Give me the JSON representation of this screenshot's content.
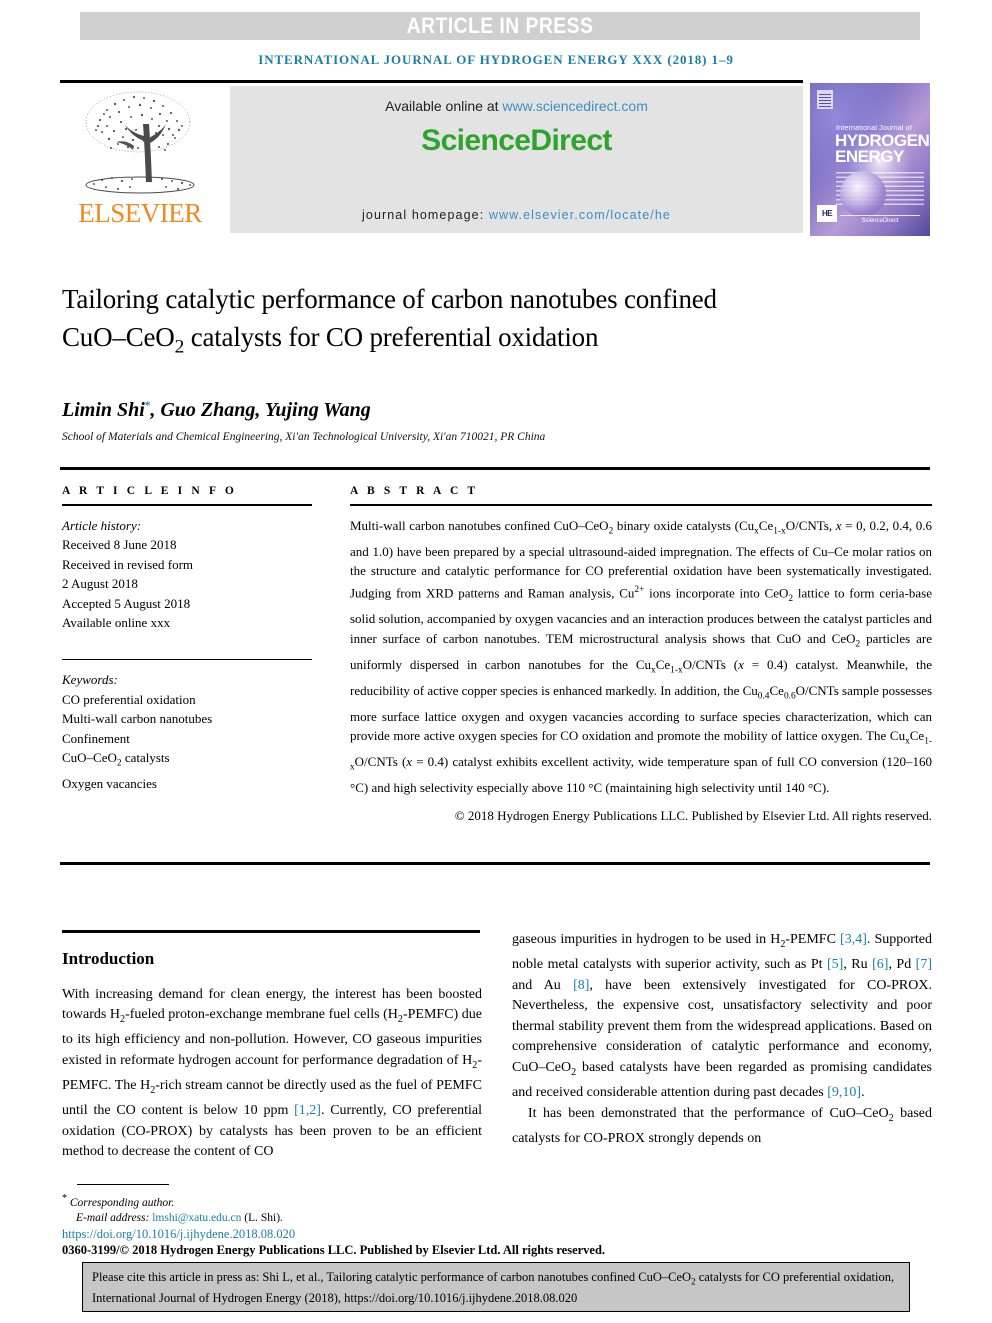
{
  "banner": {
    "label": "ARTICLE IN PRESS",
    "bg_color": "#cfcfcf",
    "text_color": "#ffffff"
  },
  "running_head": {
    "text": "INTERNATIONAL JOURNAL OF HYDROGEN ENERGY XXX (2018) 1–9",
    "color": "#1a7fa8"
  },
  "masthead": {
    "publisher": "ELSEVIER",
    "publisher_color": "#F08A1E",
    "available_prefix": "Available online at ",
    "available_link": "www.sciencedirect.com",
    "sciencedirect_logo": "ScienceDirect",
    "sciencedirect_color": "#2FA32F",
    "homepage_prefix": "journal homepage: ",
    "homepage_link": "www.elsevier.com/locate/he",
    "link_color": "#3a8fc4"
  },
  "cover": {
    "line_small": "International Journal of",
    "line_big_1": "HYDROGEN",
    "line_big_2": "ENERGY",
    "imprint": "HE",
    "publisher_footer": "ScienceDirect"
  },
  "article": {
    "title": "Tailoring catalytic performance of carbon nanotubes confined CuO–CeO₂ catalysts for CO preferential oxidation",
    "authors": "Limin Shi*, Guo Zhang, Yujing Wang",
    "affiliation": "School of Materials and Chemical Engineering, Xi'an Technological University, Xi'an 710021, PR China"
  },
  "info": {
    "heading": "A R T I C L E   I N F O",
    "history_label": "Article history:",
    "history": [
      "Received 8 June 2018",
      "Received in revised form",
      "2 August 2018",
      "Accepted 5 August 2018",
      "Available online xxx"
    ],
    "keywords_label": "Keywords:",
    "keywords": [
      "CO preferential oxidation",
      "Multi-wall carbon nanotubes",
      "Confinement",
      "CuO–CeO₂ catalysts",
      "Oxygen vacancies"
    ]
  },
  "abstract": {
    "heading": "A B S T R A C T",
    "body": "Multi-wall carbon nanotubes confined CuO–CeO₂ binary oxide catalysts (CuₓCe₁₋ₓO/CNTs, x = 0, 0.2, 0.4, 0.6 and 1.0) have been prepared by a special ultrasound-aided impregnation. The effects of Cu–Ce molar ratios on the structure and catalytic performance for CO preferential oxidation have been systematically investigated. Judging from XRD patterns and Raman analysis, Cu²⁺ ions incorporate into CeO₂ lattice to form ceria-base solid solution, accompanied by oxygen vacancies and an interaction produces between the catalyst particles and inner surface of carbon nanotubes. TEM microstructural analysis shows that CuO and CeO₂ particles are uniformly dispersed in carbon nanotubes for the CuₓCe₁₋ₓO/CNTs (x = 0.4) catalyst. Meanwhile, the reducibility of active copper species is enhanced markedly. In addition, the Cu₀.₄Ce₀.₆O/CNTs sample possesses more surface lattice oxygen and oxygen vacancies according to surface species characterization, which can provide more active oxygen species for CO oxidation and promote the mobility of lattice oxygen. The CuₓCe₁₋ₓO/CNTs (x = 0.4) catalyst exhibits excellent activity, wide temperature span of full CO conversion (120–160 °C) and high selectivity especially above 110 °C (maintaining high selectivity until 140 °C).",
    "copyright": "© 2018 Hydrogen Energy Publications LLC. Published by Elsevier Ltd. All rights reserved."
  },
  "body": {
    "intro_heading": "Introduction",
    "left_para": "With increasing demand for clean energy, the interest has been boosted towards H₂-fueled proton-exchange membrane fuel cells (H₂-PEMFC) due to its high efficiency and non-pollution. However, CO gaseous impurities existed in reformate hydrogen account for performance degradation of H₂-PEMFC. The H₂-rich stream cannot be directly used as the fuel of PEMFC until the CO content is below 10 ppm [1,2]. Currently, CO preferential oxidation (CO-PROX) by catalysts has been proven to be an efficient method to decrease the content of CO",
    "right_para_1": "gaseous impurities in hydrogen to be used in H₂-PEMFC [3,4]. Supported noble metal catalysts with superior activity, such as Pt [5], Ru [6], Pd [7] and Au [8], have been extensively investigated for CO-PROX. Nevertheless, the expensive cost, unsatisfactory selectivity and poor thermal stability prevent them from the widespread applications. Based on comprehensive consideration of catalytic performance and economy, CuO–CeO₂ based catalysts have been regarded as promising candidates and received considerable attention during past decades [9,10].",
    "right_para_2": "It has been demonstrated that the performance of CuO–CeO₂ based catalysts for CO-PROX strongly depends on"
  },
  "footer": {
    "corresponding": "Corresponding author.",
    "email_label": "E-mail address: ",
    "email": "lmshi@xatu.edu.cn",
    "email_suffix": " (L. Shi).",
    "doi": "https://doi.org/10.1016/j.ijhydene.2018.08.020",
    "issn": "0360-3199/© 2018 Hydrogen Energy Publications LLC. Published by Elsevier Ltd. All rights reserved.",
    "link_color": "#1a7fa8"
  },
  "cite_box": {
    "text": "Please cite this article in press as: Shi L, et al., Tailoring catalytic performance of carbon nanotubes confined CuO–CeO₂ catalysts for CO preferential oxidation, International Journal of Hydrogen Energy (2018), https://doi.org/10.1016/j.ijhydene.2018.08.020",
    "bg_color": "#c6c6c6"
  }
}
